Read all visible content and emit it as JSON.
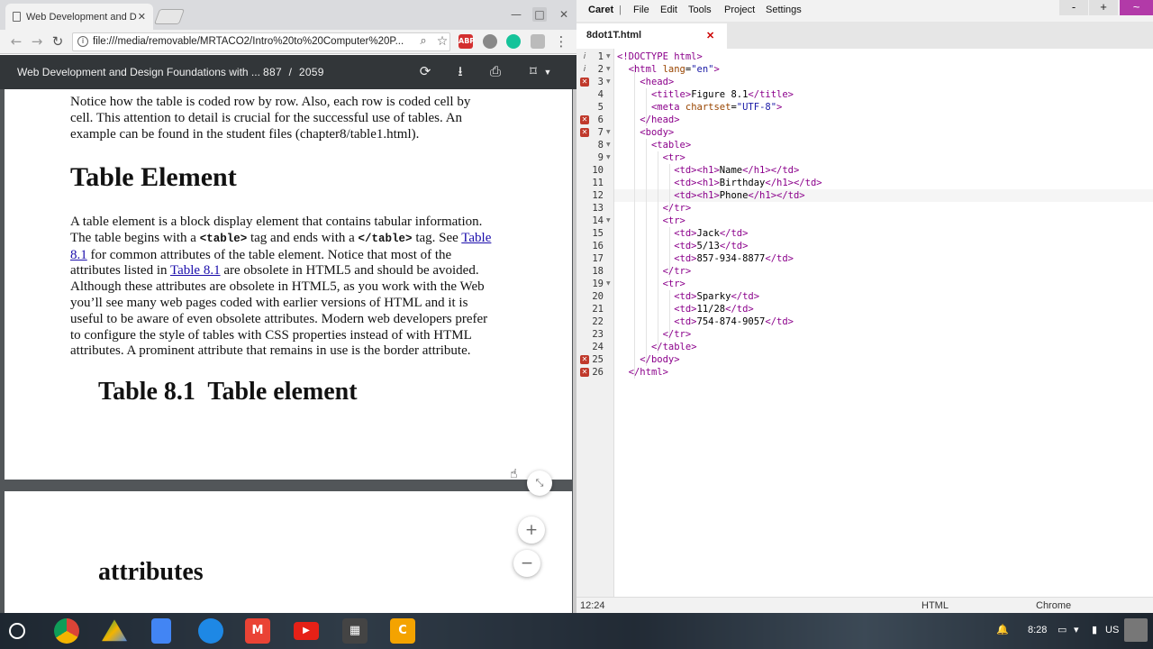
{
  "browser": {
    "tab_title": "Web Development and D",
    "url": "file:///media/removable/MRTACO2/Intro%20to%20Computer%20P...",
    "ext_abp": "ABP"
  },
  "pdf": {
    "title": "Web Development and Design Foundations with ...",
    "page_current": "887",
    "page_sep": "/",
    "page_total": "2059",
    "intro_lines": [
      "Notice how the table is coded row by row. Also, each row is coded cell by",
      "cell. This attention to detail is crucial for the successful use of tables. An",
      "example can be found in the student files (chapter8/table1.html)."
    ],
    "heading": "Table Element",
    "b1": "A table element is a block display element that contains tabular information.",
    "b2a": "The table begins with a ",
    "b2code1": "<table>",
    "b2b": " tag and ends with a ",
    "b2code2": "</table>",
    "b2c": " tag. See ",
    "b2link": "Table",
    "b3link": "8.1",
    "b3": " for common attributes of the table element. Notice that most of the",
    "b4a": "attributes listed in ",
    "b4link": "Table 8.1",
    "b4b": " are obsolete in HTML5 and should be avoided.",
    "body_rest": [
      "Although these attributes are obsolete in HTML5, as you work with the Web",
      "you’ll see many web pages coded with earlier versions of HTML and it is",
      "useful to be aware of even obsolete attributes. Modern web developers prefer",
      "to configure the style of tables with CSS properties instead of with HTML",
      "attributes. A prominent attribute that remains in use is the border attribute."
    ],
    "table_caption": "Table 8.1  Table element",
    "page2_heading": "attributes",
    "zoom_in": "+",
    "zoom_out": "−"
  },
  "caret": {
    "menu": [
      "Caret",
      "|",
      "File",
      "Edit",
      "Tools",
      "Project",
      "Settings"
    ],
    "win_min": "-",
    "win_max": "+",
    "win_extra": "~",
    "file_tab": "8dot1T.html",
    "close": "✕",
    "status_pos": "12:24",
    "status_mode": "HTML",
    "status_target": "Chrome",
    "current_line": 12,
    "lines": [
      {
        "n": "1",
        "m": "info",
        "fold": true,
        "html": "<span class=tg>&lt;!DOCTYPE html&gt;</span>"
      },
      {
        "n": "2",
        "m": "info",
        "fold": true,
        "html": "  <span class=tg>&lt;html</span> <span class=at>lang</span>=<span class=st>\"en\"</span><span class=tg>&gt;</span>"
      },
      {
        "n": "3",
        "m": "err",
        "fold": true,
        "html": "    <span class=tg>&lt;head&gt;</span>"
      },
      {
        "n": "4",
        "m": "",
        "fold": false,
        "html": "      <span class=tg>&lt;title&gt;</span>Figure 8.1<span class=tg>&lt;/title&gt;</span>"
      },
      {
        "n": "5",
        "m": "",
        "fold": false,
        "html": "      <span class=tg>&lt;meta</span> <span class=at>chartset</span>=<span class=st>\"UTF-8\"</span><span class=tg>&gt;</span>"
      },
      {
        "n": "6",
        "m": "err",
        "fold": false,
        "html": "    <span class=tg>&lt;/head&gt;</span>"
      },
      {
        "n": "7",
        "m": "err",
        "fold": true,
        "html": "    <span class=tg>&lt;body&gt;</span>"
      },
      {
        "n": "8",
        "m": "",
        "fold": true,
        "html": "      <span class=tg>&lt;table&gt;</span>"
      },
      {
        "n": "9",
        "m": "",
        "fold": true,
        "html": "        <span class=tg>&lt;tr&gt;</span>"
      },
      {
        "n": "10",
        "m": "",
        "fold": false,
        "html": "          <span class=tg>&lt;td&gt;&lt;h1&gt;</span>Name<span class=tg>&lt;/h1&gt;&lt;/td&gt;</span>"
      },
      {
        "n": "11",
        "m": "",
        "fold": false,
        "html": "          <span class=tg>&lt;td&gt;&lt;h1&gt;</span>Birthday<span class=tg>&lt;/h1&gt;&lt;/td&gt;</span>"
      },
      {
        "n": "12",
        "m": "",
        "fold": false,
        "html": "          <span class=tg>&lt;td&gt;&lt;h1&gt;</span>Phone<span class=tg>&lt;/h1&gt;&lt;/td&gt;</span>"
      },
      {
        "n": "13",
        "m": "",
        "fold": false,
        "html": "        <span class=tg>&lt;/tr&gt;</span>"
      },
      {
        "n": "14",
        "m": "",
        "fold": true,
        "html": "        <span class=tg>&lt;tr&gt;</span>"
      },
      {
        "n": "15",
        "m": "",
        "fold": false,
        "html": "          <span class=tg>&lt;td&gt;</span>Jack<span class=tg>&lt;/td&gt;</span>"
      },
      {
        "n": "16",
        "m": "",
        "fold": false,
        "html": "          <span class=tg>&lt;td&gt;</span>5/13<span class=tg>&lt;/td&gt;</span>"
      },
      {
        "n": "17",
        "m": "",
        "fold": false,
        "html": "          <span class=tg>&lt;td&gt;</span>857-934-8877<span class=tg>&lt;/td&gt;</span>"
      },
      {
        "n": "18",
        "m": "",
        "fold": false,
        "html": "        <span class=tg>&lt;/tr&gt;</span>"
      },
      {
        "n": "19",
        "m": "",
        "fold": true,
        "html": "        <span class=tg>&lt;tr&gt;</span>"
      },
      {
        "n": "20",
        "m": "",
        "fold": false,
        "html": "          <span class=tg>&lt;td&gt;</span>Sparky<span class=tg>&lt;/td&gt;</span>"
      },
      {
        "n": "21",
        "m": "",
        "fold": false,
        "html": "          <span class=tg>&lt;td&gt;</span>11/28<span class=tg>&lt;/td&gt;</span>"
      },
      {
        "n": "22",
        "m": "",
        "fold": false,
        "html": "          <span class=tg>&lt;td&gt;</span>754-874-9057<span class=tg>&lt;/td&gt;</span>"
      },
      {
        "n": "23",
        "m": "",
        "fold": false,
        "html": "        <span class=tg>&lt;/tr&gt;</span>"
      },
      {
        "n": "24",
        "m": "",
        "fold": false,
        "html": "      <span class=tg>&lt;/table&gt;</span>"
      },
      {
        "n": "25",
        "m": "err",
        "fold": false,
        "html": "    <span class=tg>&lt;/body&gt;</span>"
      },
      {
        "n": "26",
        "m": "err",
        "fold": false,
        "html": "  <span class=tg>&lt;/html&gt;</span>"
      }
    ]
  },
  "shelf": {
    "time": "8:28",
    "locale": "US",
    "apps": [
      "chrome-icon",
      "drive-icon",
      "docs-icon",
      "files-icon",
      "gmail-icon",
      "youtube-icon",
      "video-icon",
      "caret-icon"
    ]
  }
}
